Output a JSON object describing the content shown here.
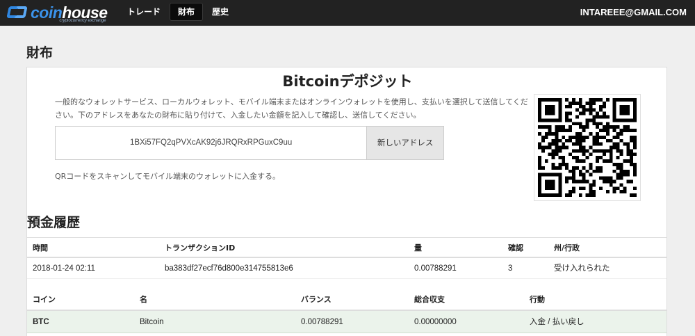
{
  "brand": {
    "name_coin": "coin",
    "name_house": "house",
    "tagline": "cryptocurrency exchange",
    "color": "#2f86e0"
  },
  "nav": {
    "items": [
      {
        "label": "トレード"
      },
      {
        "label": "財布",
        "active": true
      },
      {
        "label": "歴史"
      }
    ]
  },
  "user": {
    "email": "INTAREEE@GMAIL.COM"
  },
  "page": {
    "title": "財布"
  },
  "deposit": {
    "title": "Bitcoinデポジット",
    "description": "一般的なウォレットサービス、ローカルウォレット、モバイル端末またはオンラインウォレットを使用し、支払いを選択して送信してください。下のアドレスをあなたの財布に貼り付けて、入金したい金額を記入して確認し、送信してください。",
    "address": "1BXi57FQ2qPVXcAK92j6JRQRxRPGuxC9uu",
    "new_address_label": "新しいアドレス",
    "qr_note": "QRコードをスキャンしてモバイル端末のウォレットに入金する。",
    "qr_icon": "qr-code"
  },
  "history": {
    "title": "預金履歴",
    "columns": [
      "時間",
      "トランザクションID",
      "量",
      "確認",
      "州/行政"
    ],
    "rows": [
      [
        "2018-01-24 02:11",
        "ba383df27ecf76d800e314755813e6",
        "0.00788291",
        "3",
        "受け入れられた"
      ]
    ]
  },
  "balances": {
    "columns": [
      "コイン",
      "名",
      "バランス",
      "総合収支",
      "行動"
    ],
    "rows": [
      {
        "coin": "BTC",
        "name": "Bitcoin",
        "balance": "0.00788291",
        "total": "0.00000000",
        "action_deposit": "入金",
        "action_sep": " / ",
        "action_withdraw": "払い戻し"
      }
    ],
    "highlight_color": "#ebf3eb"
  }
}
